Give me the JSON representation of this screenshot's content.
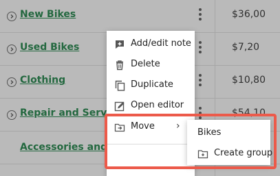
{
  "table": {
    "rows": [
      {
        "name": "New Bikes",
        "amount": "$36,00",
        "expandable": true
      },
      {
        "name": "Used Bikes",
        "amount": "$7,20",
        "expandable": true
      },
      {
        "name": "Clothing",
        "amount": "$10,80",
        "expandable": true
      },
      {
        "name": "Repair and Service",
        "amount": "$54,10",
        "expandable": true
      },
      {
        "name": "Accessories and Parts",
        "amount": "",
        "expandable": false
      }
    ]
  },
  "context_menu": {
    "items": [
      {
        "label": "Add/edit note",
        "icon": "note-add-icon"
      },
      {
        "label": "Delete",
        "icon": "trash-icon"
      },
      {
        "label": "Duplicate",
        "icon": "duplicate-icon"
      },
      {
        "label": "Open editor",
        "icon": "edit-icon"
      },
      {
        "label": "Move",
        "icon": "folder-move-icon"
      }
    ]
  },
  "submenu": {
    "items": [
      {
        "label": "Bikes"
      },
      {
        "label": "Create group",
        "icon": "folder-add-icon"
      }
    ]
  },
  "colors": {
    "link_green": "#21864a",
    "highlight_red": "#ec5a4a"
  }
}
